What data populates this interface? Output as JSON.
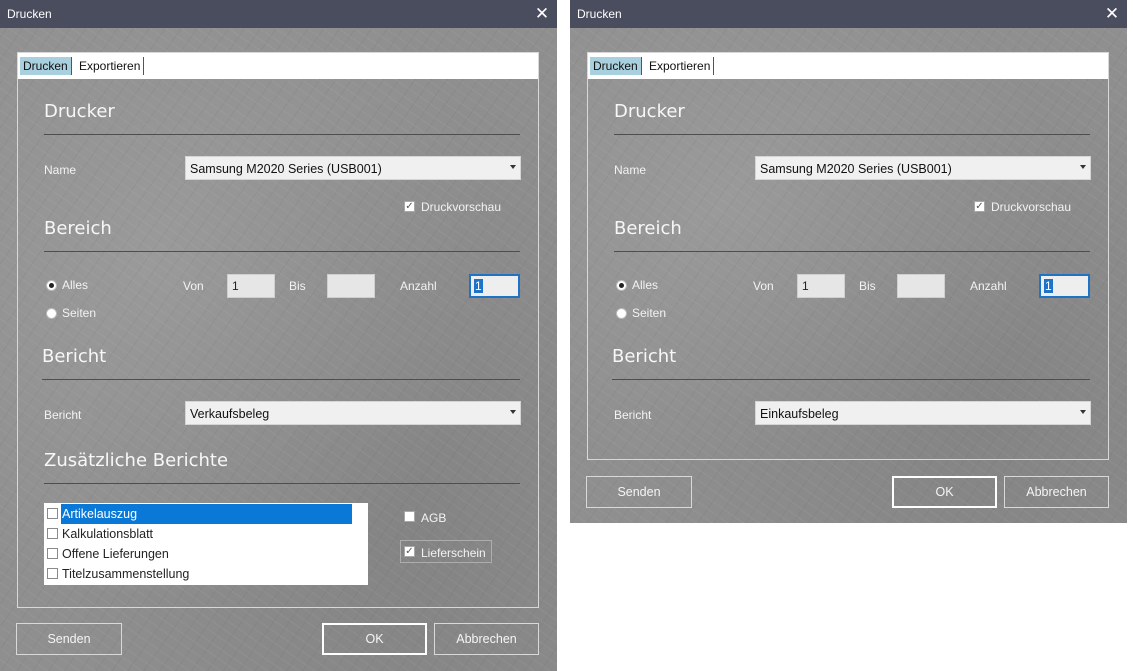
{
  "dialogs": [
    {
      "title": "Drucken",
      "close_glyph": "✕",
      "tabs": [
        "Drucken",
        "Exportieren"
      ],
      "printer": {
        "heading": "Drucker",
        "name_label": "Name",
        "name_value": "Samsung M2020 Series (USB001)",
        "preview_label": "Druckvorschau",
        "preview_checked": true
      },
      "range": {
        "heading": "Bereich",
        "option_all": "Alles",
        "option_pages": "Seiten",
        "selected": "Alles",
        "from_label": "Von",
        "from_value": "1",
        "to_label": "Bis",
        "to_value": "",
        "count_label": "Anzahl",
        "count_value": "1"
      },
      "report": {
        "heading": "Bericht",
        "label": "Bericht",
        "value": "Verkaufsbeleg"
      },
      "additional": {
        "heading": "Zusätzliche Berichte",
        "items": [
          {
            "label": "Artikelauszug",
            "checked": false,
            "selected": true
          },
          {
            "label": "Kalkulationsblatt",
            "checked": false,
            "selected": false
          },
          {
            "label": "Offene Lieferungen",
            "checked": false,
            "selected": false
          },
          {
            "label": "Titelzusammenstellung",
            "checked": false,
            "selected": false
          }
        ],
        "agb_label": "AGB",
        "agb_checked": false,
        "lieferschein_label": "Lieferschein",
        "lieferschein_checked": true
      },
      "buttons": {
        "send": "Senden",
        "ok": "OK",
        "cancel": "Abbrechen"
      }
    },
    {
      "title": "Drucken",
      "close_glyph": "✕",
      "tabs": [
        "Drucken",
        "Exportieren"
      ],
      "printer": {
        "heading": "Drucker",
        "name_label": "Name",
        "name_value": "Samsung M2020 Series (USB001)",
        "preview_label": "Druckvorschau",
        "preview_checked": true
      },
      "range": {
        "heading": "Bereich",
        "option_all": "Alles",
        "option_pages": "Seiten",
        "selected": "Alles",
        "from_label": "Von",
        "from_value": "1",
        "to_label": "Bis",
        "to_value": "",
        "count_label": "Anzahl",
        "count_value": "1"
      },
      "report": {
        "heading": "Bericht",
        "label": "Bericht",
        "value": "Einkaufsbeleg"
      },
      "buttons": {
        "send": "Senden",
        "ok": "OK",
        "cancel": "Abbrechen"
      }
    }
  ],
  "colors": {
    "titlebar": "#4a4d5e",
    "dialog_bg": "#8f8f8f",
    "active_tab": "#a9d0de",
    "selection": "#0a78d7",
    "focus_border": "#1e72c8"
  },
  "icons": {
    "close": "close-icon",
    "dropdown": "chevron-down-icon",
    "checkbox": "checkbox-icon",
    "radio": "radio-icon"
  }
}
